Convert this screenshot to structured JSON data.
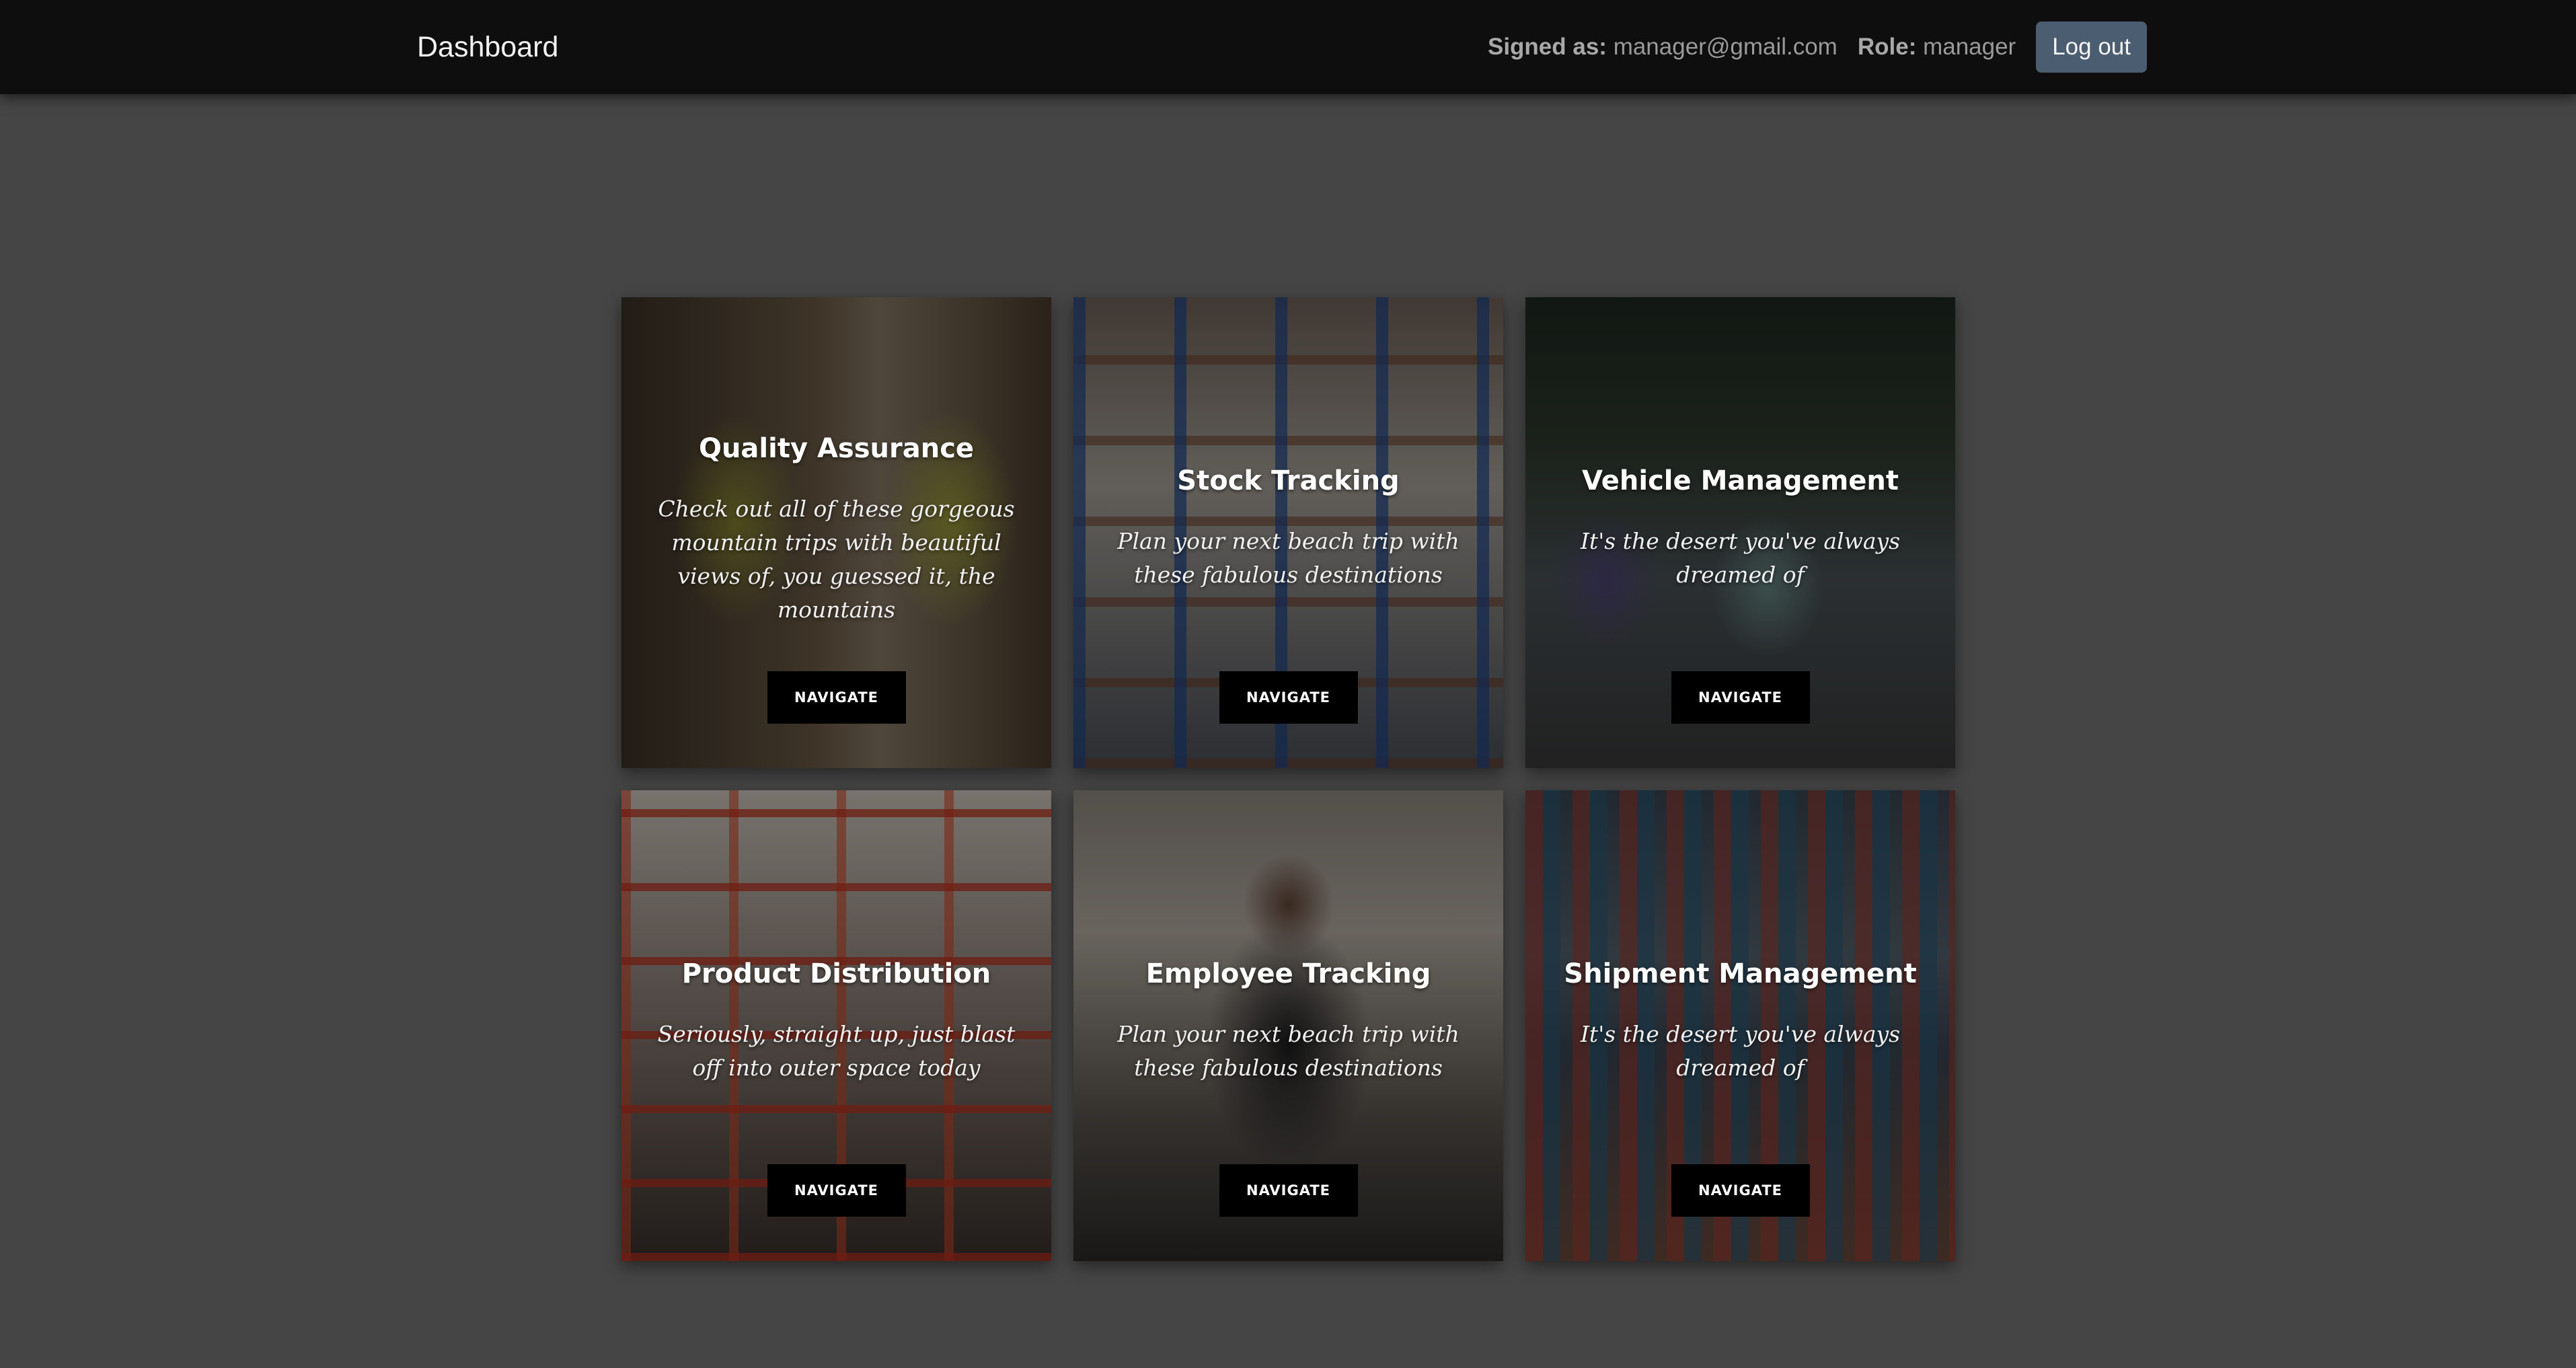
{
  "navbar": {
    "brand": "Dashboard",
    "signed_label": "Signed as:",
    "signed_value": "manager@gmail.com",
    "role_label": "Role:",
    "role_value": "manager",
    "logout_label": "Log out"
  },
  "cards": [
    {
      "title": "Quality Assurance",
      "description": "Check out all of these gorgeous mountain trips with beautiful views of, you guessed it, the mountains",
      "button": "NAVIGATE"
    },
    {
      "title": "Stock Tracking",
      "description": "Plan your next beach trip with these fabulous destinations",
      "button": "NAVIGATE"
    },
    {
      "title": "Vehicle Management",
      "description": "It's the desert you've always dreamed of",
      "button": "NAVIGATE"
    },
    {
      "title": "Product Distribution",
      "description": "Seriously, straight up, just blast off into outer space today",
      "button": "NAVIGATE"
    },
    {
      "title": "Employee Tracking",
      "description": "Plan your next beach trip with these fabulous destinations",
      "button": "NAVIGATE"
    },
    {
      "title": "Shipment Management",
      "description": "It's the desert you've always dreamed of",
      "button": "NAVIGATE"
    }
  ],
  "colors": {
    "navbar_bg": "#0e0e0e",
    "page_bg": "#454545",
    "logout_bg": "#4b5d70"
  }
}
